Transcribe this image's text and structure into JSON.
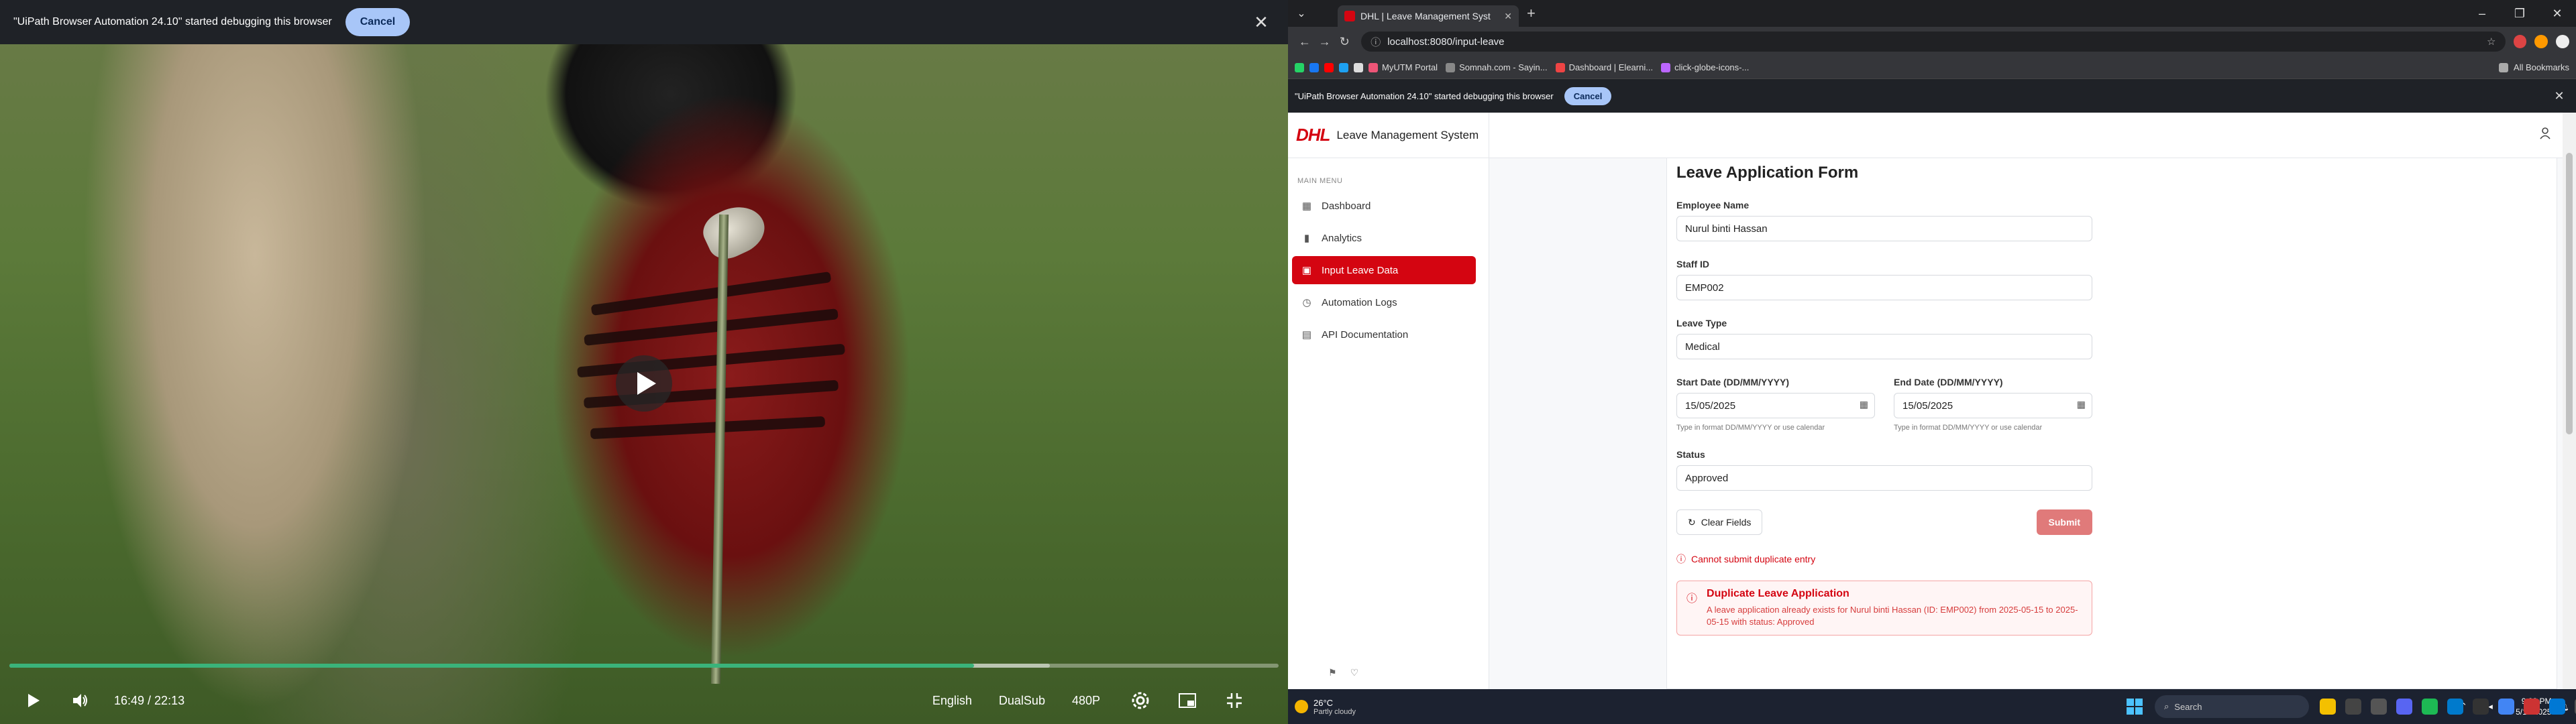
{
  "video": {
    "debug_message": "\"UiPath Browser Automation 24.10\" started debugging this browser",
    "cancel_label": "Cancel",
    "close_icon": "close-icon",
    "time": "16:49 / 22:13",
    "language": "English",
    "dual_sub": "DualSub",
    "quality": "480P",
    "progress_played": 0.76,
    "progress_buffered": 0.82,
    "colors": {
      "progress": "#3ab37a"
    }
  },
  "browser": {
    "tab_title": "DHL | Leave Management Syst",
    "url": "localhost:8080/input-leave",
    "bookmarks": [
      "MyUTM Portal",
      "Somnah.com - Sayin...",
      "Dashboard | Elearni...",
      "click-globe-icons-..."
    ],
    "all_bookmarks": "All Bookmarks",
    "debug_message": "\"UiPath Browser Automation 24.10\" started debugging this browser",
    "cancel_label": "Cancel"
  },
  "app": {
    "brand": "DHL",
    "title": "Leave Management System",
    "menu_label": "MAIN MENU",
    "menu": [
      {
        "label": "Dashboard",
        "icon": "grid-icon"
      },
      {
        "label": "Analytics",
        "icon": "bar-chart-icon"
      },
      {
        "label": "Input Leave Data",
        "icon": "file-plus-icon"
      },
      {
        "label": "Automation Logs",
        "icon": "timer-icon"
      },
      {
        "label": "API Documentation",
        "icon": "document-icon"
      }
    ],
    "active_index": 2,
    "colors": {
      "brand": "#d40511",
      "submit_disabled": "#e07a7a"
    }
  },
  "form": {
    "title": "Leave Application Form",
    "employee_label": "Employee Name",
    "employee_value": "Nurul binti Hassan",
    "staff_label": "Staff ID",
    "staff_value": "EMP002",
    "leave_type_label": "Leave Type",
    "leave_type_value": "Medical",
    "start_label": "Start Date (DD/MM/YYYY)",
    "start_value": "15/05/2025",
    "end_label": "End Date (DD/MM/YYYY)",
    "end_value": "15/05/2025",
    "date_hint": "Type in format DD/MM/YYYY or use calendar",
    "status_label": "Status",
    "status_value": "Approved",
    "clear_label": "Clear Fields",
    "submit_label": "Submit",
    "inline_error": "Cannot submit duplicate entry",
    "error_title": "Duplicate Leave Application",
    "error_detail": "A leave application already exists for Nurul binti Hassan (ID: EMP002) from 2025-05-15 to 2025-05-15 with status: Approved"
  },
  "taskbar": {
    "temperature": "26°C",
    "weather": "Partly cloudy",
    "search": "Search",
    "time": "9:23 PM",
    "date": "5/10/2025"
  }
}
